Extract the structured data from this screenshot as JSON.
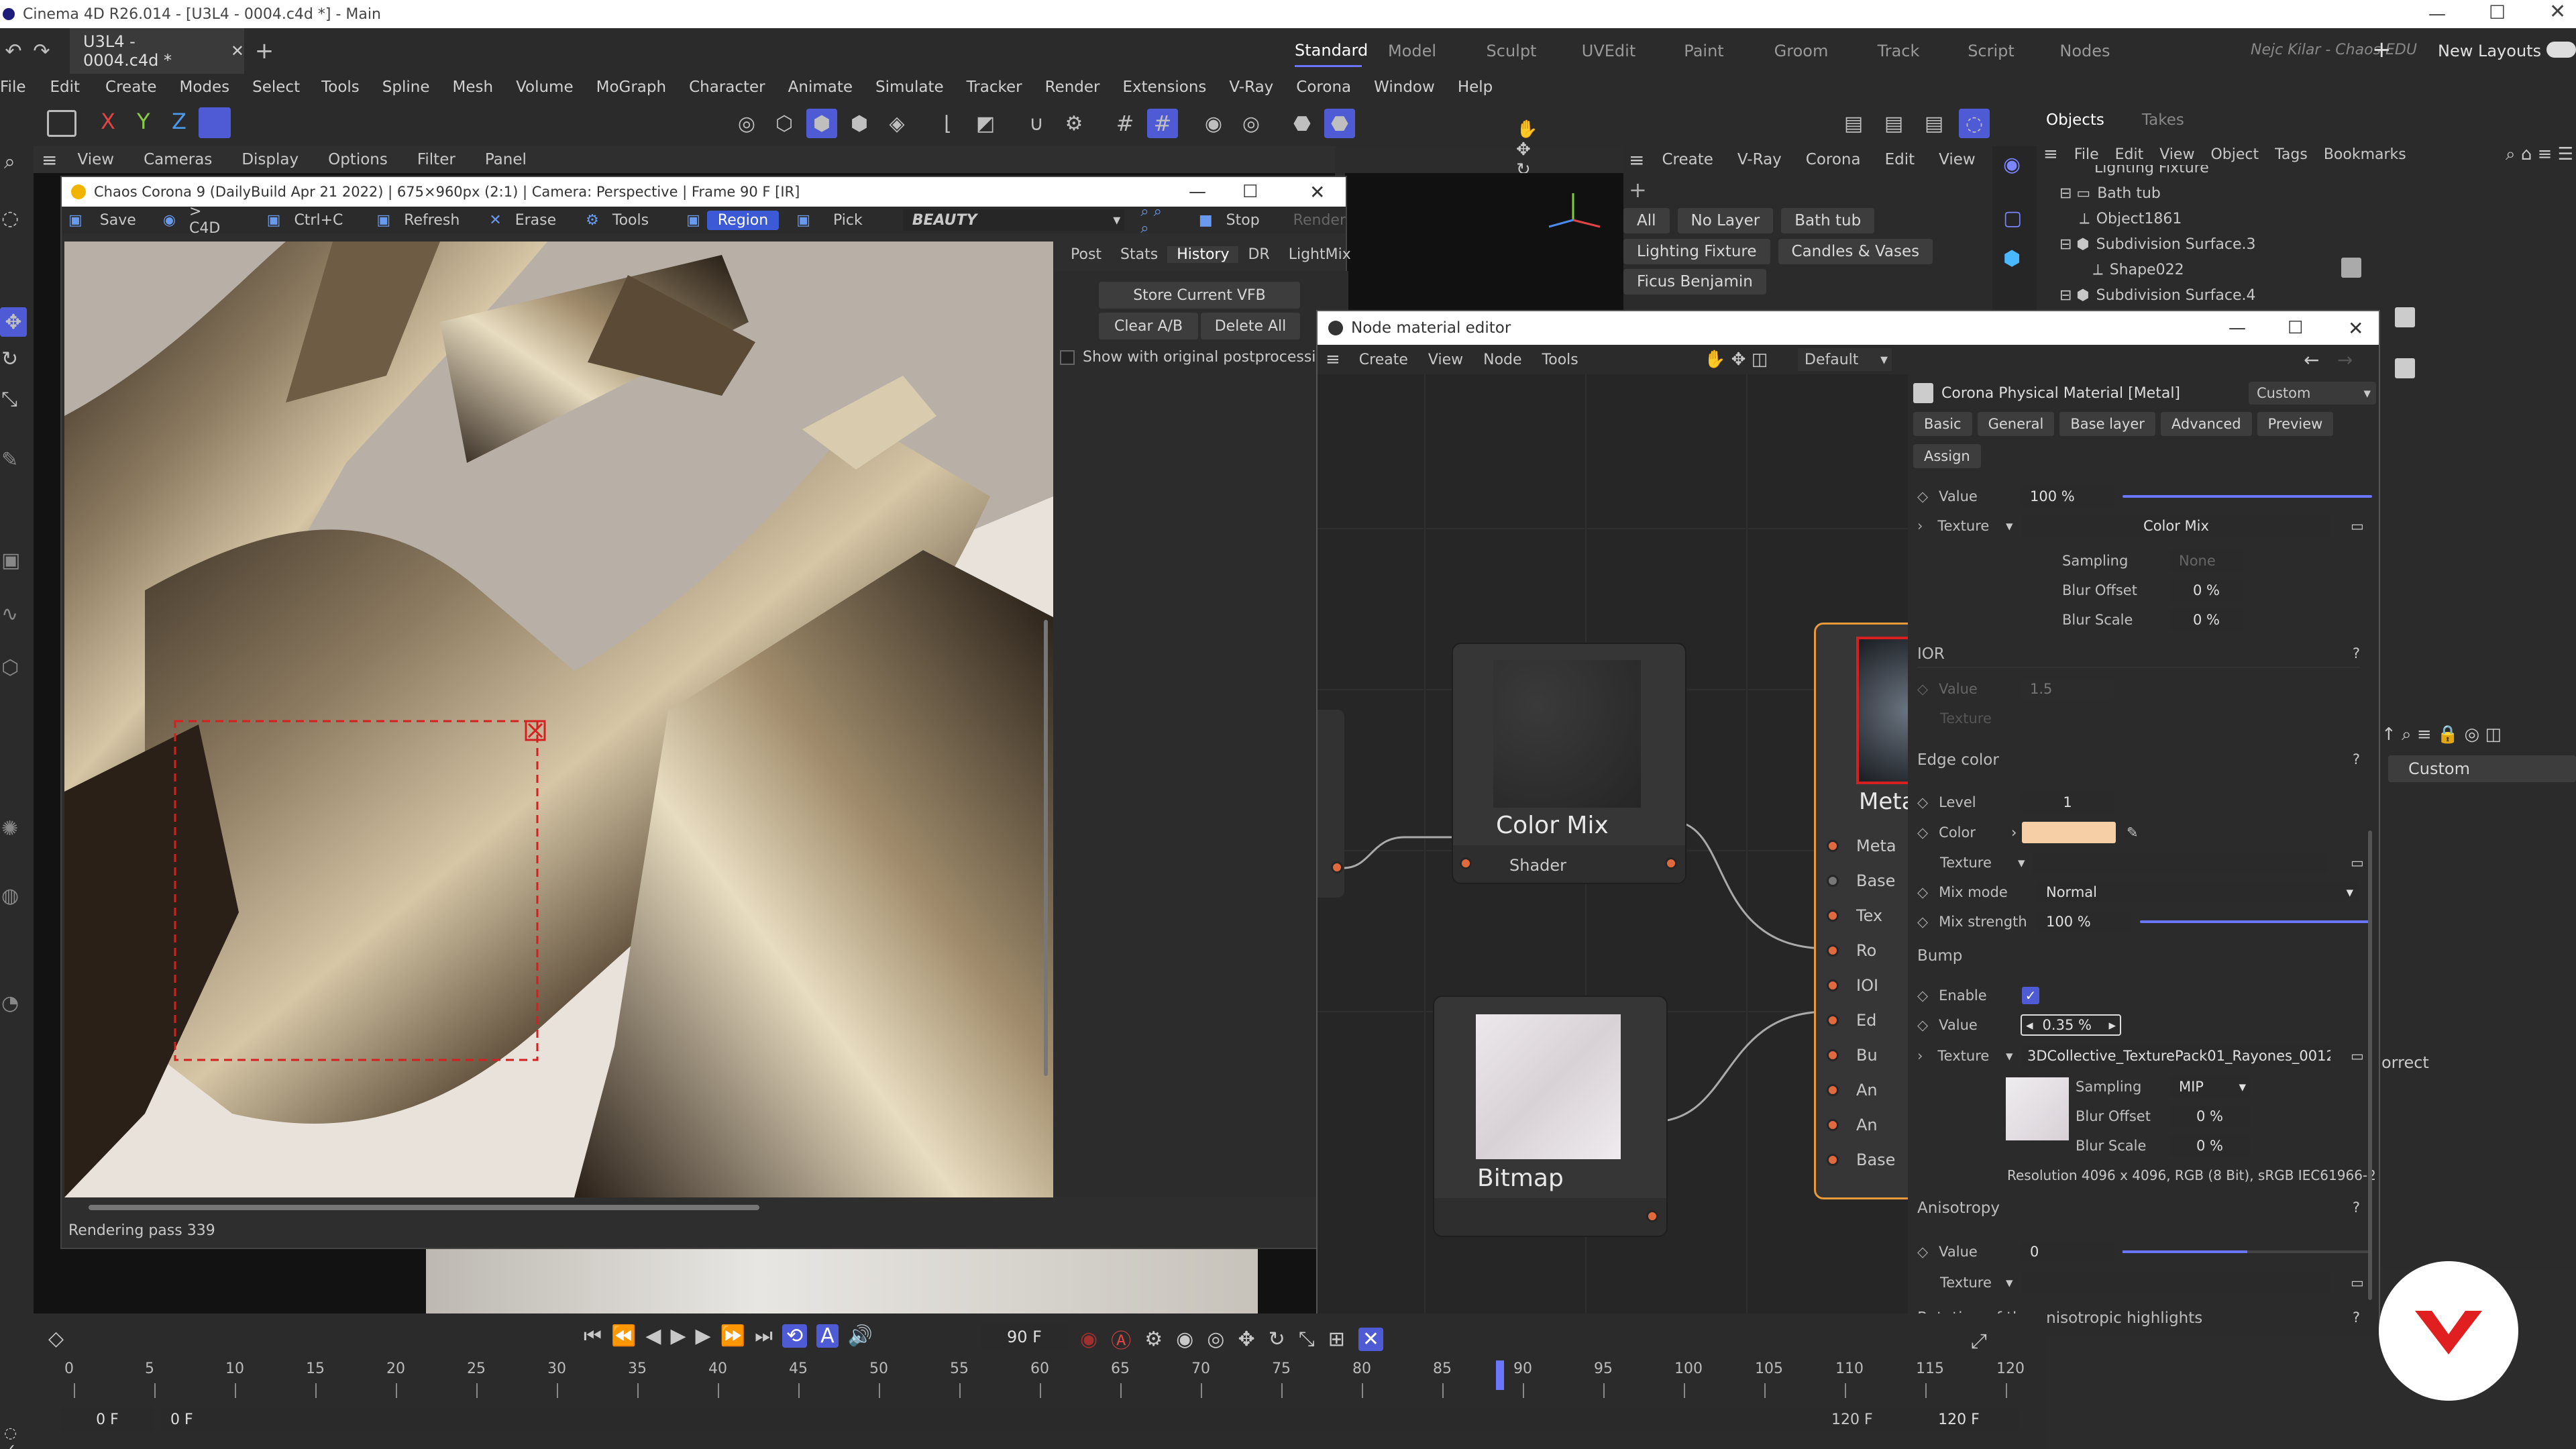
{
  "window": {
    "title": "Cinema 4D R26.014 - [U3L4 - 0004.c4d *] - Main"
  },
  "tab": {
    "name": "U3L4 - 0004.c4d *"
  },
  "layouts": [
    "Standard",
    "Model",
    "Sculpt",
    "UVEdit",
    "Paint",
    "Groom",
    "Track",
    "Script",
    "Nodes"
  ],
  "user": "Nejc Kilar - Chaos EDU",
  "new_layouts": "New Layouts",
  "menu": [
    "File",
    "Edit",
    "Create",
    "Modes",
    "Select",
    "Tools",
    "Spline",
    "Mesh",
    "Volume",
    "MoGraph",
    "Character",
    "Animate",
    "Simulate",
    "Tracker",
    "Render",
    "Extensions",
    "V-Ray",
    "Corona",
    "Window",
    "Help"
  ],
  "axes": {
    "x": "X",
    "y": "Y",
    "z": "Z"
  },
  "viewport_menu": [
    "View",
    "Cameras",
    "Display",
    "Options",
    "Filter",
    "Panel"
  ],
  "layer_menu": [
    "Create",
    "V-Ray",
    "Corona",
    "Edit",
    "View"
  ],
  "layer_buttons": [
    "All",
    "No Layer",
    "Bath tub"
  ],
  "layer_buttons2": [
    "Lighting Fixture",
    "Candles & Vases"
  ],
  "layer_buttons3": [
    "Ficus Benjamin"
  ],
  "objects": {
    "tabs": [
      "Objects",
      "Takes"
    ],
    "menu": [
      "File",
      "Edit",
      "View",
      "Object",
      "Tags",
      "Bookmarks"
    ],
    "items": [
      "Lighting Fixture",
      "Bath tub",
      "Object1861",
      "Subdivision Surface.3",
      "Shape022",
      "Subdivision Surface.4"
    ]
  },
  "vfb": {
    "title": "Chaos Corona 9 (DailyBuild Apr 21 2022) | 675×960px (2:1) | Camera: Perspective | Frame 90 F [IR]",
    "toolbar": [
      "Save",
      "> C4D",
      "Ctrl+C",
      "Refresh",
      "Erase",
      "Tools",
      "Region",
      "Pick"
    ],
    "channel": "BEAUTY",
    "stop": "Stop",
    "render": "Render",
    "tabs": [
      "Post",
      "Stats",
      "History",
      "DR",
      "LightMix"
    ],
    "store": "Store Current VFB",
    "clear": "Clear A/B",
    "delete": "Delete All",
    "show_original": "Show with original postprocessing",
    "status": "Rendering pass 339"
  },
  "node_editor": {
    "title": "Node material editor",
    "menu": [
      "Create",
      "View",
      "Node",
      "Tools"
    ],
    "preset": "Default",
    "nodes": {
      "colormix": {
        "title": "Color Mix",
        "port": "Shader"
      },
      "bitmap": {
        "title": "Bitmap"
      },
      "metal": {
        "title": "Meta",
        "ports": [
          "Meta",
          "Base",
          "Tex",
          "Ro",
          "IOI",
          "Ed",
          "Bu",
          "An",
          "An",
          "Base"
        ]
      }
    }
  },
  "attributes": {
    "material": "Corona Physical Material [Metal]",
    "mode": "Custom",
    "tabs": [
      "Basic",
      "General",
      "Base layer",
      "Advanced",
      "Preview"
    ],
    "assign": "Assign",
    "value_label": "Value",
    "value": "100 %",
    "texture_label": "Texture",
    "texture_name": "Color Mix",
    "sampling_label": "Sampling",
    "sampling_none": "None",
    "blur_offset_label": "Blur Offset",
    "blur_offset": "0 %",
    "blur_scale_label": "Blur Scale",
    "blur_scale": "0 %",
    "ior_label": "IOR",
    "ior_value": "1.5",
    "edge_color_label": "Edge color",
    "level_label": "Level",
    "level": "1",
    "color_label": "Color",
    "edge_color": "#f6cfa6",
    "mix_mode_label": "Mix mode",
    "mix_mode": "Normal",
    "mix_strength_label": "Mix strength",
    "mix_strength": "100 %",
    "bump_label": "Bump",
    "enable_label": "Enable",
    "bump_value": "0.35 %",
    "bump_texture": "3DCollective_TexturePack01_Rayones_0012_",
    "sampling_mip": "MIP",
    "resolution": "Resolution 4096 x 4096, RGB (8 Bit), sRGB IEC61966-2",
    "anisotropy_label": "Anisotropy",
    "aniso_value": "0",
    "rotation_label": "Rotation of the anisotropic highlights",
    "right_custom": "Custom",
    "right_correct": "orrect"
  },
  "timeline": {
    "current_frame": "90 F",
    "ticks": [
      "0",
      "5",
      "10",
      "15",
      "20",
      "25",
      "30",
      "35",
      "40",
      "45",
      "50",
      "55",
      "60",
      "65",
      "70",
      "75",
      "80",
      "85",
      "90",
      "95",
      "100",
      "105",
      "110",
      "115",
      "120"
    ],
    "start": "0 F",
    "start2": "0 F",
    "end": "120 F",
    "end2": "120 F"
  }
}
